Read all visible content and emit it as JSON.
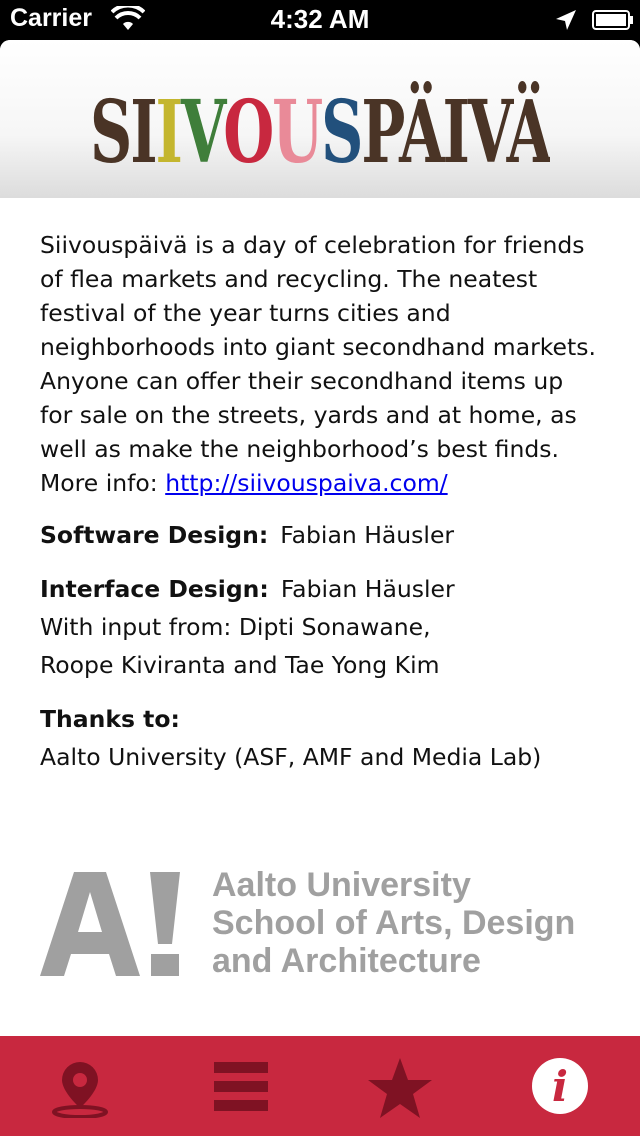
{
  "status": {
    "carrier": "Carrier",
    "time": "4:32 AM"
  },
  "header": {
    "logo_text": "SIIVOUSPÄIVÄ"
  },
  "about": {
    "description": "Siivouspäivä is a day of celebration for friends of flea markets and recycling. The neatest festival of the year turns cities and neighborhoods into giant secondhand markets. Anyone can offer their secondhand items up for sale on the streets, yards and at home, as well as make the neighborhood’s best finds.",
    "more_info_label": "More info:",
    "more_info_link": "http://siivouspaiva.com/",
    "software_label": "Software Design:",
    "software_name": "Fabian Häusler",
    "interface_label": "Interface Design:",
    "interface_name": "Fabian Häusler",
    "input_line1": "With input from: Dipti Sonawane,",
    "input_line2": "Roope Kiviranta and Tae Yong Kim",
    "thanks_label": "Thanks to:",
    "thanks_text": "Aalto University (ASF, AMF and Media Lab)"
  },
  "aalto_logo": {
    "line1": "Aalto University",
    "line2": "School of Arts, Design",
    "line3": "and Architecture",
    "color": "#a0a0a0"
  },
  "tabbar": {
    "color": "#c8283f",
    "tabs": [
      {
        "icon": "map-pin-icon"
      },
      {
        "icon": "list-icon"
      },
      {
        "icon": "star-icon"
      },
      {
        "icon": "info-icon",
        "selected": true
      }
    ]
  }
}
